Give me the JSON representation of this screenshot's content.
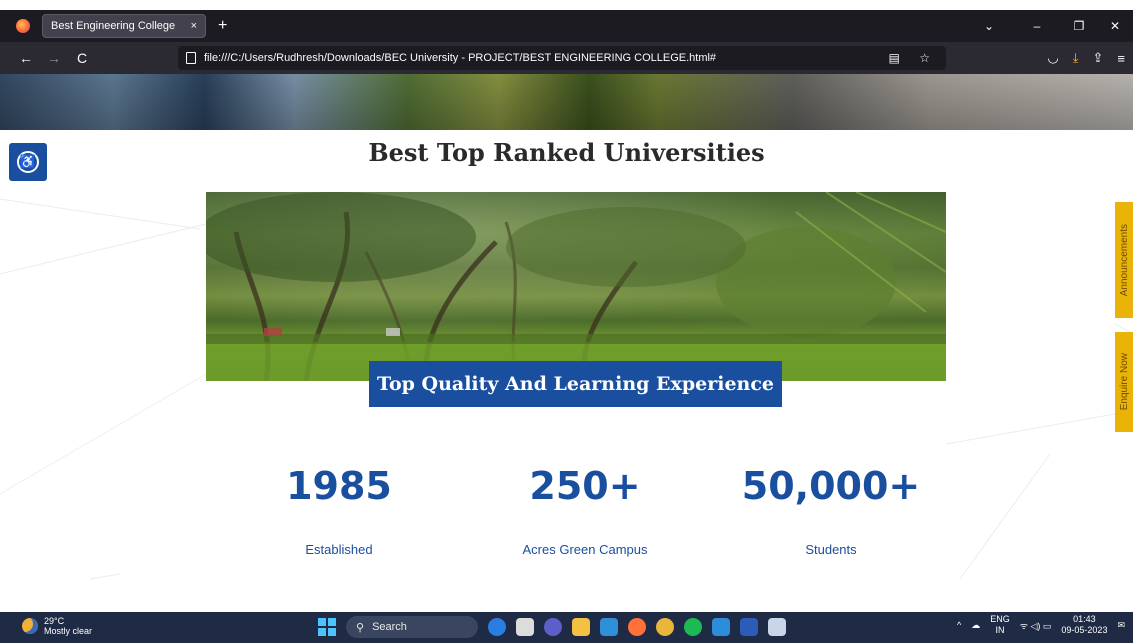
{
  "browser": {
    "tab_title": "Best Engineering College",
    "tab_close": "×",
    "new_tab": "+",
    "url": "file:///C:/Users/Rudhresh/Downloads/BEC University - PROJECT/BEST ENGINEERING COLLEGE.html#",
    "back": "←",
    "forward": "→",
    "reload": "C",
    "win_list": "⌄",
    "win_min": "–",
    "win_restore": "❐",
    "win_close": "✕",
    "reader_icon": "▤",
    "bookmark_icon": "☆",
    "pocket_icon": "◡",
    "download_icon": "⤓",
    "share_icon": "⇪",
    "menu_icon": "≡"
  },
  "page": {
    "section_title": "Best Top Ranked Universities",
    "caption": "Top Quality And Learning Experience",
    "stats": [
      {
        "number": "1985",
        "label": "Established"
      },
      {
        "number": "250+",
        "label": "Acres Green Campus"
      },
      {
        "number": "50,000+",
        "label": "Students"
      }
    ],
    "side_tabs": {
      "announcements": "Announcements",
      "enquire": "Enquire Now"
    },
    "accessibility_icon": "accessibility-icon"
  },
  "taskbar": {
    "temperature": "29°C",
    "weather": "Mostly clear",
    "search_placeholder": "Search",
    "lang_top": "ENG",
    "lang_bottom": "IN",
    "time": "01:43",
    "date": "09-05-2023",
    "tray_chevron": "^",
    "tray_icons": "ᯤ ◁) ▭"
  },
  "colors": {
    "brand_blue": "#1a4fa0",
    "side_tab_yellow": "#eab308",
    "browser_dark": "#1c1b22",
    "taskbar": "#1f2a44"
  }
}
